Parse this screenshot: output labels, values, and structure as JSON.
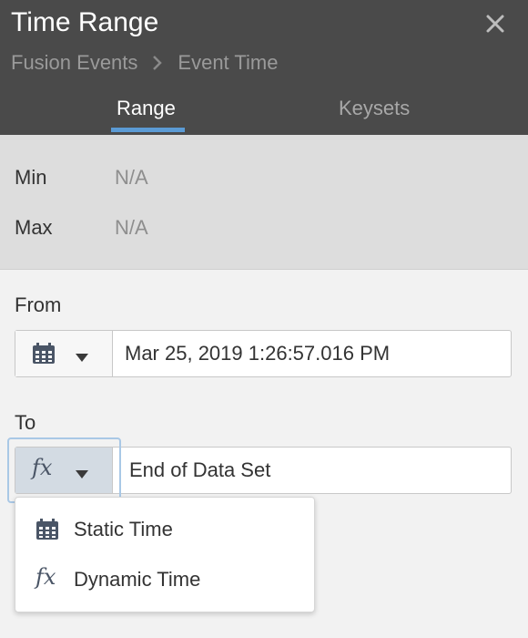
{
  "header": {
    "title": "Time Range",
    "close_icon": "close-icon",
    "breadcrumb": [
      "Fusion Events",
      "Event Time"
    ],
    "tabs": [
      {
        "label": "Range",
        "active": true
      },
      {
        "label": "Keysets",
        "active": false
      }
    ]
  },
  "stats": {
    "min": {
      "label": "Min",
      "value": "N/A"
    },
    "max": {
      "label": "Max",
      "value": "N/A"
    }
  },
  "from": {
    "label": "From",
    "type_icon": "calendar-icon",
    "value": "Mar 25, 2019 1:26:57.016 PM"
  },
  "to": {
    "label": "To",
    "type_icon": "fx-icon",
    "type_glyph": "fx",
    "value": "End of Data Set"
  },
  "menu": {
    "items": [
      {
        "label": "Static Time",
        "icon": "calendar-icon"
      },
      {
        "label": "Dynamic Time",
        "icon": "fx-icon",
        "glyph": "fx"
      }
    ]
  },
  "colors": {
    "header_bg": "#4a4a4a",
    "accent": "#5b9bd5",
    "stats_bg": "#dddddd",
    "body_bg": "#f2f2f2"
  }
}
